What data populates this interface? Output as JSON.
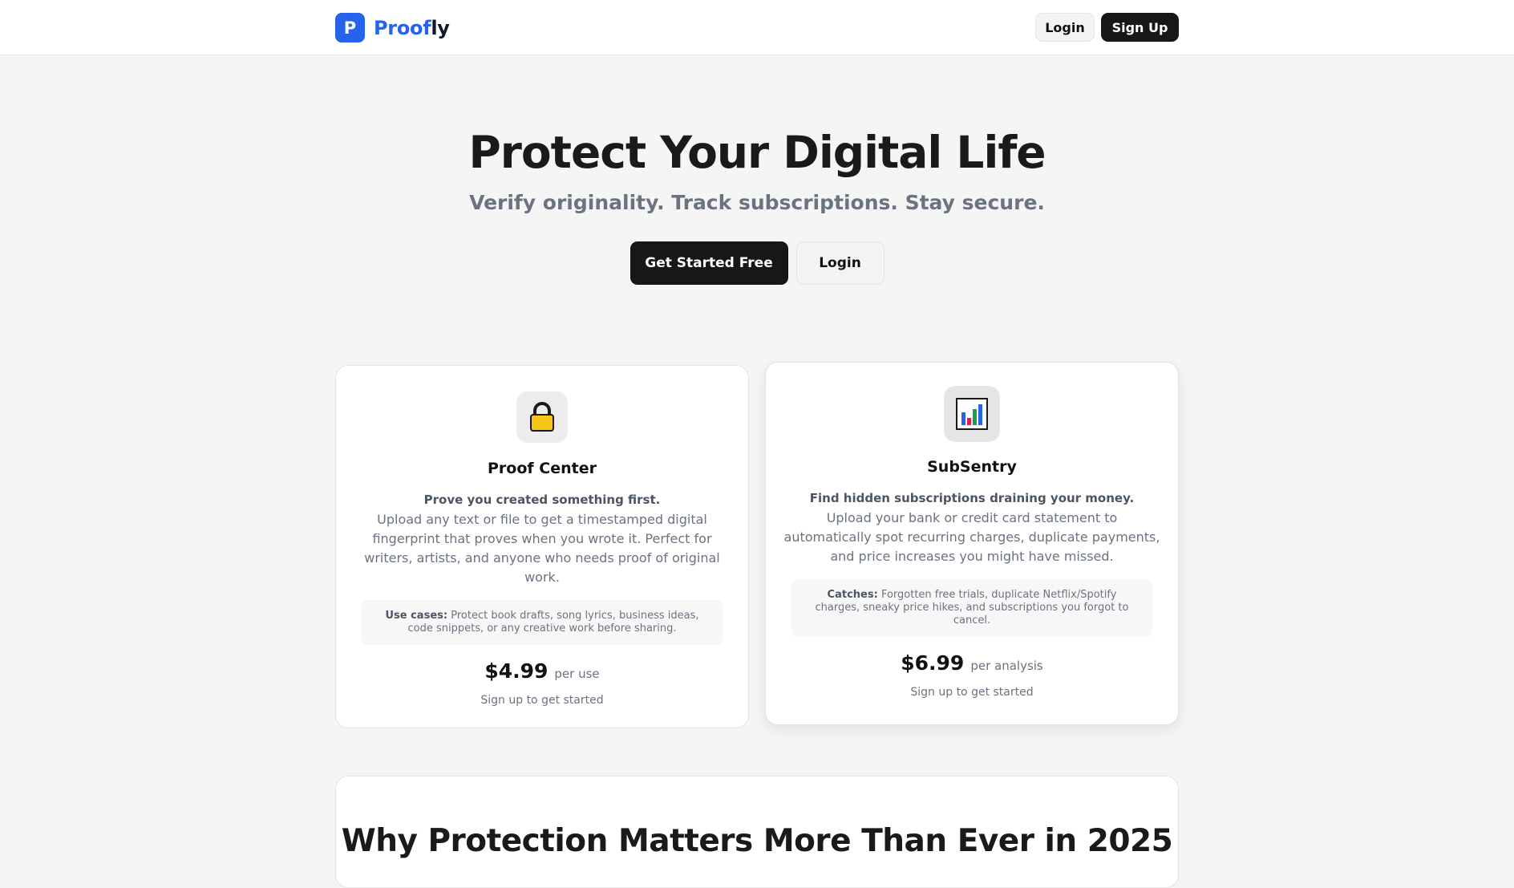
{
  "header": {
    "logo_letter": "P",
    "brand_part1": "Proof",
    "brand_part2": "ly",
    "login_label": "Login",
    "signup_label": "Sign Up"
  },
  "hero": {
    "title": "Protect Your Digital Life",
    "subtitle": "Verify originality. Track subscriptions. Stay secure.",
    "primary_cta": "Get Started Free",
    "secondary_cta": "Login"
  },
  "cards": [
    {
      "icon": "lock-icon",
      "title": "Proof Center",
      "lead": "Prove you created something first.",
      "description": "Upload any text or file to get a timestamped digital fingerprint that proves when you wrote it. Perfect for writers, artists, and anyone who needs proof of original work.",
      "detail_label": "Use cases:",
      "detail_text": "Protect book drafts, song lyrics, business ideas, code snippets, or any creative work before sharing.",
      "price": "$4.99",
      "price_unit": "per use",
      "cta": "Sign up to get started"
    },
    {
      "icon": "bar-chart-icon",
      "title": "SubSentry",
      "lead": "Find hidden subscriptions draining your money.",
      "description": "Upload your bank or credit card statement to automatically spot recurring charges, duplicate payments, and price increases you might have missed.",
      "detail_label": "Catches:",
      "detail_text": "Forgotten free trials, duplicate Netflix/Spotify charges, sneaky price hikes, and subscriptions you forgot to cancel.",
      "price": "$6.99",
      "price_unit": "per analysis",
      "cta": "Sign up to get started"
    }
  ],
  "why": {
    "title": "Why Protection Matters More Than Ever in 2025"
  },
  "colors": {
    "brand_blue": "#2563eb",
    "dark": "#171717",
    "muted_text": "#6b7280",
    "page_bg": "#f5f5f5"
  }
}
